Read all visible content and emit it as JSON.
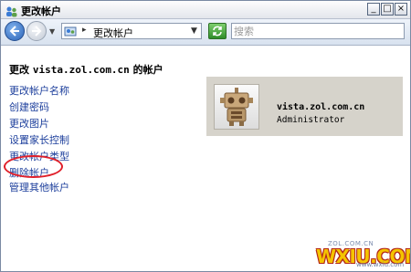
{
  "window": {
    "title": "更改帐户",
    "minimize_glyph": "_",
    "maximize_glyph": "□",
    "close_glyph": "×"
  },
  "address_bar": {
    "separator": "▸",
    "path": "更改帐户",
    "search_placeholder": "搜索"
  },
  "content": {
    "heading_prefix": "更改",
    "heading_account": "vista.zol.com.cn",
    "heading_suffix": "的帐户",
    "tasks": [
      "更改帐户名称",
      "创建密码",
      "更改图片",
      "设置家长控制",
      "更改帐户类型",
      "删除帐户"
    ],
    "other_task": "管理其他帐户"
  },
  "account": {
    "name": "vista.zol.com.cn",
    "role": "Administrator"
  },
  "watermark": {
    "small": "ZOL.COM.CN",
    "big": "WXIU.COM",
    "url": "www.wxiu.com"
  },
  "colors": {
    "link": "#1d3f9c",
    "highlight_circle": "#e0202a",
    "account_panel": "#d6d3cb"
  }
}
